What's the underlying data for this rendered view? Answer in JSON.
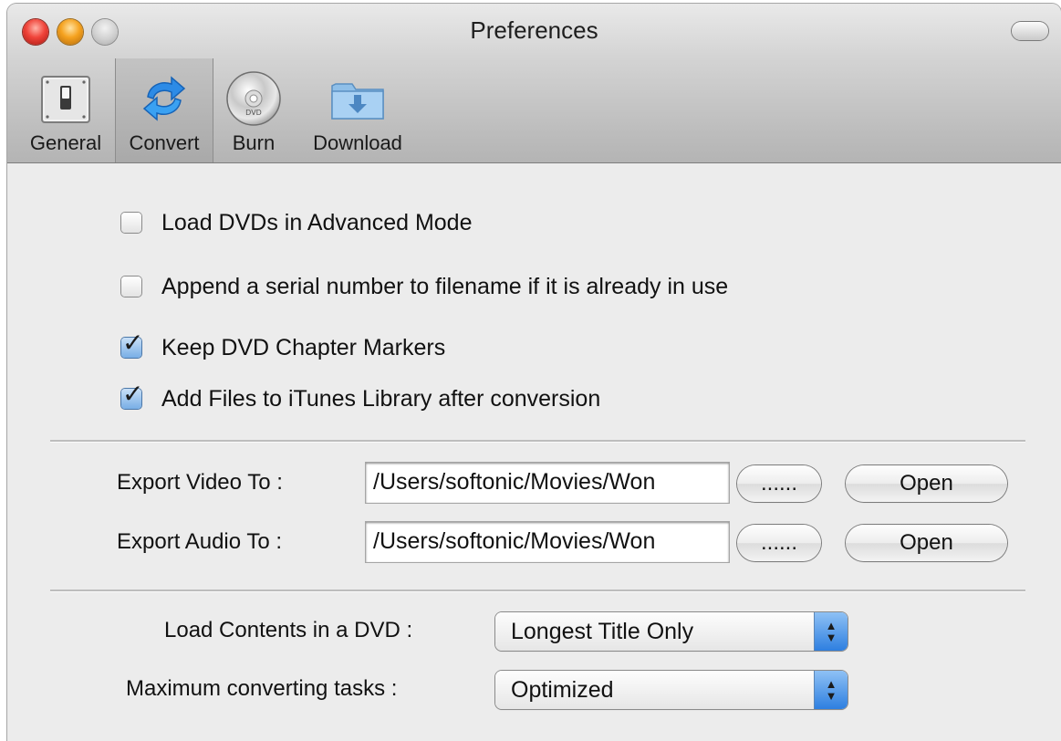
{
  "window": {
    "title": "Preferences"
  },
  "toolbar": {
    "items": [
      {
        "label": "General",
        "icon": "switch-icon",
        "selected": false
      },
      {
        "label": "Convert",
        "icon": "convert-arrows-icon",
        "selected": true
      },
      {
        "label": "Burn",
        "icon": "dvd-disc-icon",
        "selected": false
      },
      {
        "label": "Download",
        "icon": "download-folder-icon",
        "selected": false
      }
    ]
  },
  "options": [
    {
      "label": "Load DVDs in Advanced Mode",
      "checked": false
    },
    {
      "label": "Append a serial number to filename if it is already in use",
      "checked": false
    },
    {
      "label": "Keep DVD Chapter Markers",
      "checked": true
    },
    {
      "label": "Add Files to iTunes Library after conversion",
      "checked": true
    }
  ],
  "export": {
    "video": {
      "label": "Export Video To :",
      "path": "/Users/softonic/Movies/Won",
      "browse_label": "......",
      "open_label": "Open"
    },
    "audio": {
      "label": "Export Audio To :",
      "path": "/Users/softonic/Movies/Won",
      "browse_label": "......",
      "open_label": "Open"
    }
  },
  "dropdowns": {
    "load_contents": {
      "label": "Load Contents in a DVD :",
      "value": "Longest Title Only"
    },
    "max_tasks": {
      "label": "Maximum converting tasks :",
      "value": "Optimized"
    }
  },
  "colors": {
    "titlebar": "#c9c9c9",
    "window_bg": "#ececec",
    "checkbox_on": "#78aee6",
    "select_arrow": "#2e7fe0"
  }
}
